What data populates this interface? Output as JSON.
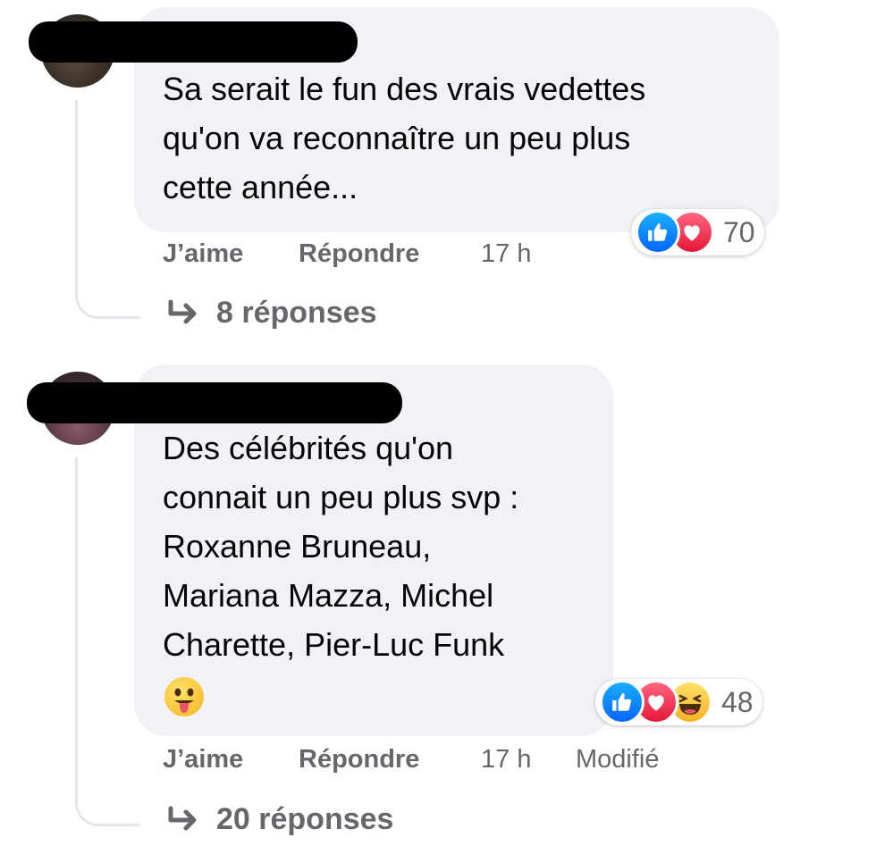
{
  "comments": [
    {
      "text": "Sa serait le fun des vrais vedettes qu'on va reconnaître un peu plus cette année...",
      "lines": [
        "Sa serait le fun des vrais vedettes",
        "qu'on va reconnaître un peu plus",
        "cette année..."
      ],
      "reactions": {
        "icons": [
          "like-icon",
          "love-icon"
        ],
        "count": "70"
      },
      "actions": {
        "like": "J’aime",
        "reply": "Répondre",
        "time": "17 h"
      },
      "replies_label": "8 réponses"
    },
    {
      "text": "Des célébrités qu'on connait un peu plus svp : Roxanne Bruneau, Mariana Mazza, Michel Charette, Pier-Luc Funk 😛",
      "lines": [
        "Des célébrités qu'on",
        "connait un peu plus svp :",
        "Roxanne Bruneau,",
        "Mariana Mazza, Michel",
        "Charette, Pier-Luc Funk"
      ],
      "emoji": "face-with-tongue",
      "reactions": {
        "icons": [
          "like-icon",
          "love-icon",
          "haha-icon"
        ],
        "count": "48"
      },
      "actions": {
        "like": "J’aime",
        "reply": "Répondre",
        "time": "17 h",
        "edited": "Modifié"
      },
      "replies_label": "20 réponses"
    }
  ],
  "colors": {
    "bubble": "#f0f2f5",
    "secondary_text": "#65676b",
    "like_blue": "#0866ff",
    "love_red": "#e61739",
    "haha_yellow": "#f7b125"
  }
}
